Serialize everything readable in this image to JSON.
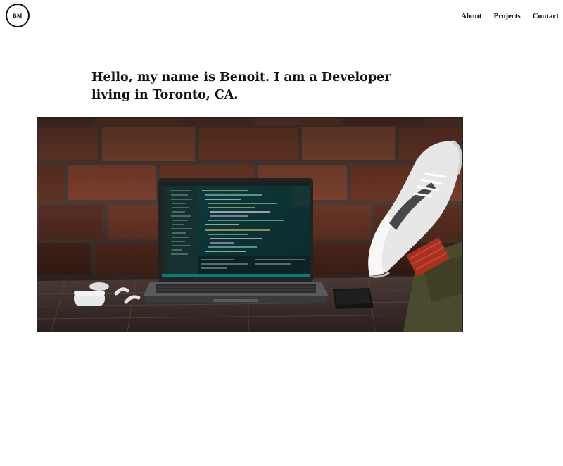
{
  "header": {
    "logo_text": "BM",
    "nav": [
      {
        "label": "About"
      },
      {
        "label": "Projects"
      },
      {
        "label": "Contact"
      }
    ]
  },
  "hero": {
    "headline": "Hello, my name is Benoit. I am a Developer living in Toronto, CA.",
    "image_subject": "laptop with code editor on desk against brick wall, sneaker resting on desk"
  }
}
